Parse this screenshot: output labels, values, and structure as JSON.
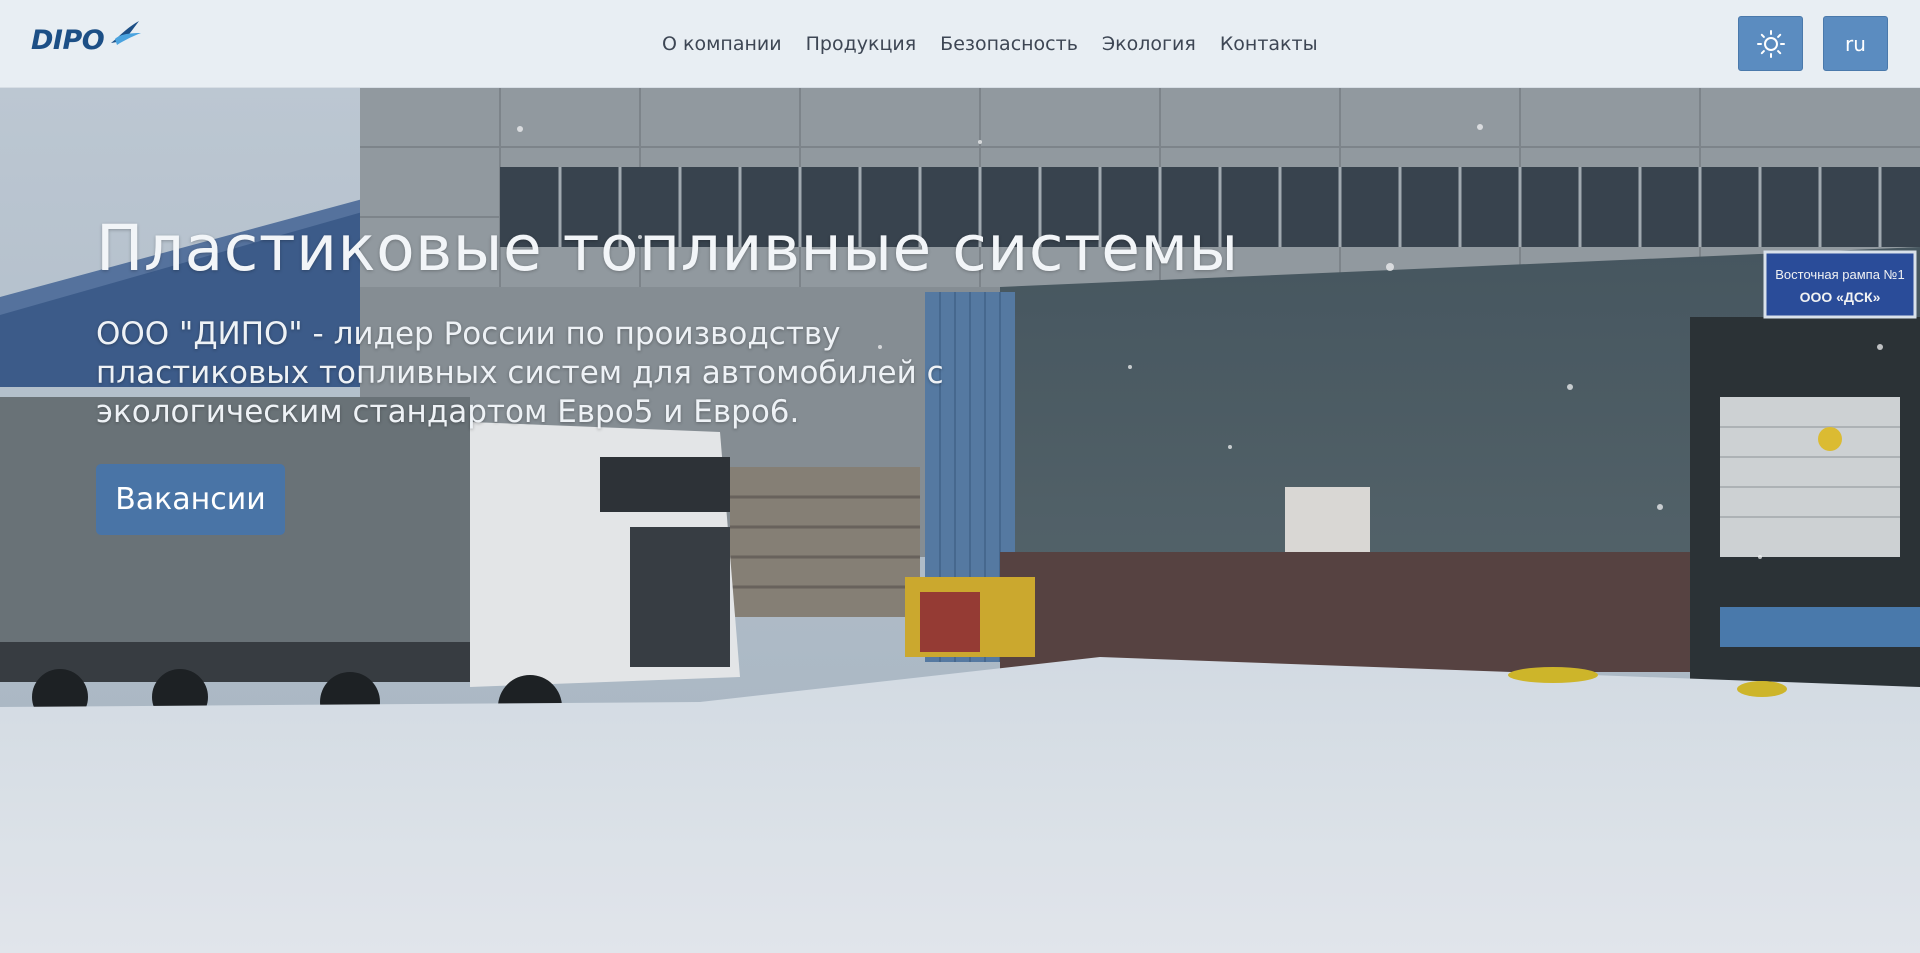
{
  "navbar": {
    "logo_text": "DIPO",
    "links": [
      {
        "label": "О компании"
      },
      {
        "label": "Продукция"
      },
      {
        "label": "Безопасность"
      },
      {
        "label": "Экология"
      },
      {
        "label": "Контакты"
      }
    ],
    "theme_toggle_icon": "sun-icon",
    "language_label": "ru"
  },
  "hero": {
    "title": "Пластиковые топливные системы",
    "subtitle": "ООО \"ДИПО\" - лидер России по производству пластиковых топливных систем для автомобилей с экологическим стандартом Евро5 и Евро6.",
    "button_label": "Вакансии",
    "sign_line1": "Восточная рампа №1",
    "sign_line2": "ООО «ДСК»"
  },
  "colors": {
    "navbar_bg": "#e8eef3",
    "accent": "#5b8cc0",
    "logo": "#1c4f86"
  }
}
